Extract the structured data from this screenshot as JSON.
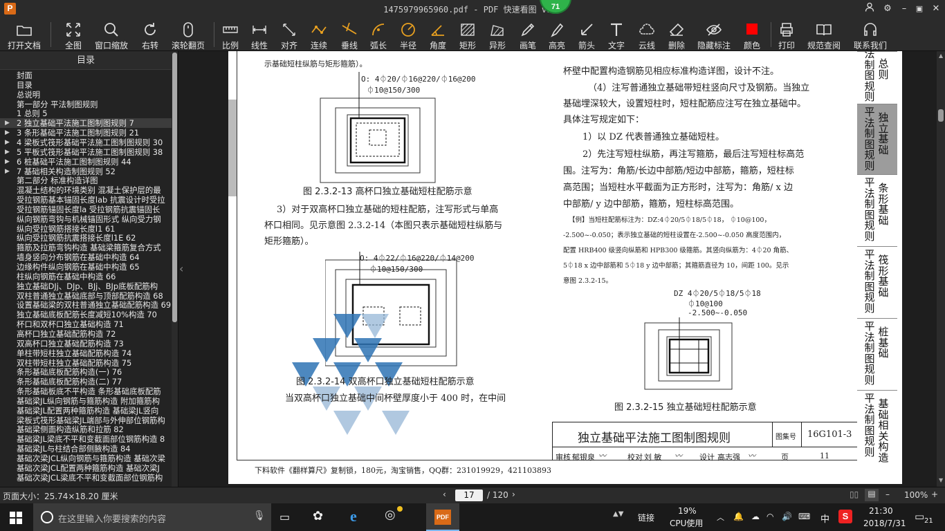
{
  "window": {
    "title": "1475979965960.pdf - PDF 快速看图 v1.9",
    "badge": "71",
    "logo": "P"
  },
  "toolbar": [
    {
      "label": "打开文档",
      "icon": "folder-icon"
    },
    {
      "label": "全图",
      "icon": "fullview-icon"
    },
    {
      "label": "窗口缩放",
      "icon": "zoom-icon"
    },
    {
      "label": "右转",
      "icon": "rotate-icon"
    },
    {
      "label": "滚轮翻页",
      "icon": "mouse-icon"
    },
    {
      "label": "比例",
      "icon": "scale-icon"
    },
    {
      "label": "线性",
      "icon": "linear-dim-icon"
    },
    {
      "label": "对齐",
      "icon": "align-dim-icon"
    },
    {
      "label": "连续",
      "icon": "continuous-dim-icon"
    },
    {
      "label": "垂线",
      "icon": "perpendicular-icon"
    },
    {
      "label": "弧长",
      "icon": "arc-length-icon"
    },
    {
      "label": "半径",
      "icon": "radius-icon"
    },
    {
      "label": "角度",
      "icon": "angle-icon"
    },
    {
      "label": "矩形",
      "icon": "rectangle-icon"
    },
    {
      "label": "异形",
      "icon": "polygon-icon"
    },
    {
      "label": "画笔",
      "icon": "brush-icon"
    },
    {
      "label": "高亮",
      "icon": "highlight-icon"
    },
    {
      "label": "箭头",
      "icon": "arrow-icon"
    },
    {
      "label": "文字",
      "icon": "text-icon"
    },
    {
      "label": "云线",
      "icon": "cloud-icon"
    },
    {
      "label": "删除",
      "icon": "eraser-icon"
    },
    {
      "label": "隐藏标注",
      "icon": "hide-icon"
    },
    {
      "label": "颜色",
      "icon": "color-icon",
      "color": "#ff0000"
    },
    {
      "label": "打印",
      "icon": "printer-icon"
    },
    {
      "label": "规范查阅",
      "icon": "book-icon"
    },
    {
      "label": "联系我们",
      "icon": "support-icon"
    }
  ],
  "sidebar": {
    "title": "目录",
    "items": [
      {
        "text": "封面",
        "indent": 0
      },
      {
        "text": "目录",
        "indent": 0
      },
      {
        "text": "总说明",
        "indent": 0
      },
      {
        "text": "第一部分  平法制图规则",
        "indent": 0
      },
      {
        "text": "1 总则 5",
        "indent": 0
      },
      {
        "text": "2 独立基础平法施工图制图规则 7",
        "indent": 1,
        "arrow": true,
        "selected": true
      },
      {
        "text": "3 条形基础平法施工图制图规则 21",
        "indent": 1,
        "arrow": true
      },
      {
        "text": "4 梁板式筏形基础平法施工图制图规则 30",
        "indent": 1,
        "arrow": true
      },
      {
        "text": "5 平板式筏形基础平法施工图制图规则 38",
        "indent": 1,
        "arrow": true
      },
      {
        "text": "6 桩基础平法施工图制图规则 44",
        "indent": 1,
        "arrow": true
      },
      {
        "text": "7 基础相关构造制图规则 52",
        "indent": 1,
        "arrow": true
      },
      {
        "text": "第二部分  标准构造详图",
        "indent": 0
      },
      {
        "text": "混凝土结构的环境类别 混凝土保护层的最",
        "indent": 0
      },
      {
        "text": "受拉钢筋基本锚固长度lab 抗震设计时受拉",
        "indent": 0
      },
      {
        "text": "受拉钢筋锚固长度la 受拉钢筋抗震锚固长",
        "indent": 0
      },
      {
        "text": "纵向钢筋弯钩与机械锚固形式 纵向受力钢",
        "indent": 0
      },
      {
        "text": "纵向受拉钢筋搭接长度l1 61",
        "indent": 0
      },
      {
        "text": "纵向受拉钢筋抗震搭接长度l1E 62",
        "indent": 0
      },
      {
        "text": "箍筋及拉筋弯钩构造 基础梁箍筋复合方式",
        "indent": 0
      },
      {
        "text": "墙身竖向分布钢筋在基础中构造 64",
        "indent": 0
      },
      {
        "text": "边缘构件纵向钢筋在基础中构造 65",
        "indent": 0
      },
      {
        "text": "柱纵向钢筋在基础中构造 66",
        "indent": 0
      },
      {
        "text": "独立基础DJj、DJp、BJj、BJp底板配筋构",
        "indent": 0
      },
      {
        "text": "双柱普通独立基础底部与顶部配筋构造 68",
        "indent": 0
      },
      {
        "text": "设置基础梁的双柱普通独立基础配筋构造 69",
        "indent": 0
      },
      {
        "text": "独立基础底板配筋长度减短10%构造 70",
        "indent": 0
      },
      {
        "text": "杯口和双杯口独立基础构造 71",
        "indent": 0
      },
      {
        "text": "高杯口独立基础配筋构造 72",
        "indent": 0
      },
      {
        "text": "双高杯口独立基础配筋构造 73",
        "indent": 0
      },
      {
        "text": "单柱带短柱独立基础配筋构造 74",
        "indent": 0
      },
      {
        "text": "双柱带短柱独立基础配筋构造 75",
        "indent": 0
      },
      {
        "text": "条形基础底板配筋构造(一) 76",
        "indent": 0
      },
      {
        "text": "条形基础底板配筋构造(二) 77",
        "indent": 0
      },
      {
        "text": "条形基础板底不平构造 条形基础底板配筋",
        "indent": 0
      },
      {
        "text": "基础梁JL纵向钢筋与箍筋构造 附加箍筋构",
        "indent": 0
      },
      {
        "text": "基础梁JL配置两种箍筋构造 基础梁JL竖向",
        "indent": 0
      },
      {
        "text": "梁板式筏形基础梁JL端部与外伸部位钢筋构",
        "indent": 0
      },
      {
        "text": "基础梁侧面构造纵筋和拉筋 82",
        "indent": 0
      },
      {
        "text": "基础梁JL梁底不平和变截面部位钢筋构造 8",
        "indent": 0
      },
      {
        "text": "基础梁JL与柱结合部侧腋构造 84",
        "indent": 0
      },
      {
        "text": "基础次梁JCL纵向钢筋与箍筋构造 基础次梁",
        "indent": 0
      },
      {
        "text": "基础次梁JCL配置两种箍筋构造 基础次梁J",
        "indent": 0
      },
      {
        "text": "基础次梁JCL梁底不平和变截面部位钢筋构",
        "indent": 0
      }
    ]
  },
  "doc": {
    "left_top": "示基础短柱纵筋与矩形箍筋）。",
    "fig13_ann1": "O: 4⏀20/⏀16@220/⏀16@200",
    "fig13_ann2": "⏀10@150/300",
    "fig13_caption": "图 2.3.2-13 高杯口独立基础短柱配筋示意",
    "p3_l1": "3）对于双高杯口独立基础的短柱配筋，注写形式与单高",
    "p3_l2": "杯口相同。见示意图 2.3.2-14（本图只表示基础短柱纵筋与",
    "p3_l3": "矩形箍筋）。",
    "fig14_ann1": "O: 4⏀22/⏀16@220/⏀14@200",
    "fig14_ann2": "⏀10@150/300",
    "fig14_caption": "图 2.3.2-14  双高杯口独立基础短柱配筋示意",
    "left_bottom": "当双高杯口独立基础中间杯壁厚度小于 400 时，在中间",
    "r1": "杯壁中配置构造钢筋见相应标准构造详图，设计不注。",
    "r2": "（4）注写普通独立基础带短柱竖向尺寸及钢筋。当独立",
    "r3": "基础埋深较大，设置短柱时，短柱配筋应注写在独立基础中。",
    "r4": "具体注写规定如下：",
    "r5": "1）以 DZ 代表普通独立基础短柱。",
    "r6": "2）先注写短柱纵筋，再注写箍筋，最后注写短柱标高范",
    "r7": "围。注写为：角筋/长边中部筋/短边中部筋，箍筋，短柱标",
    "r8": "高范围；当短柱水平截面为正方形时，注写为：角筋/ x 边",
    "r9": "中部筋/ y 边中部筋，箍筋，短柱标高范围。",
    "ex1": "【例】当短柱配筋标注为：DZ:4⏀20/5⏀18/5⏀18， ⏀10@100，",
    "ex2": "-2.500~-0.050；表示独立基础的短柱设置在-2.500~-0.050 高度范围内，",
    "ex3": "配置 HRB400 级竖向纵筋和 HPB300 级箍筋。其竖向纵筋为：4⏀20 角筋、",
    "ex4": "5⏀18 x 边中部筋和 5⏀18 y 边中部筋；其箍筋直径为 10，间距 100。见示",
    "ex5": "意图 2.3.2-15。",
    "fig15_ann1": "DZ 4⏀20/5⏀18/5⏀18",
    "fig15_ann2": "⏀10@100",
    "fig15_ann3": "-2.500~-0.050",
    "fig15_caption": "图 2.3.2-15 独立基础短柱配筋示意",
    "tb_title": "独立基础平法施工图制图规则",
    "tb_atlas_label": "图集号",
    "tb_atlas": "16G101-3",
    "tb_review": "审核",
    "tb_reviewer": "郁银泉",
    "tb_check": "校对",
    "tb_checker": "刘  敏",
    "tb_design": "设计",
    "tb_designer": "高志强",
    "tb_page_label": "页",
    "tb_page": "11",
    "watermark": "下料软件《翻样算尺》复制锁，180元，淘宝销售，QQ群：231019929，421103893"
  },
  "tabs": [
    {
      "col1": "",
      "col2": "总则",
      "col2b": "法制图规则",
      "active": false
    },
    {
      "col1": "平法制图规则",
      "col2": "独立基础",
      "active": true
    },
    {
      "col1": "平法制图规则",
      "col2": "条形基础",
      "active": false
    },
    {
      "col1": "平法制图规则",
      "col2": "筏形基础",
      "active": false
    },
    {
      "col1": "平法制图规则",
      "col2": "桩基础",
      "active": false
    },
    {
      "col1": "平法制图规则",
      "col2": "基础相关构造",
      "active": false
    }
  ],
  "status": {
    "page_size": "页面大小：25.74×18.20 厘米",
    "page_input": "17",
    "page_total": "/ 120",
    "zoom": "100%"
  },
  "taskbar": {
    "search_placeholder": "在这里输入你要搜索的内容",
    "network": "链接",
    "cpu_pct": "19%",
    "cpu_label": "CPU使用",
    "ime": "中",
    "time": "21:30",
    "date": "2018/7/31",
    "notif": "21"
  }
}
